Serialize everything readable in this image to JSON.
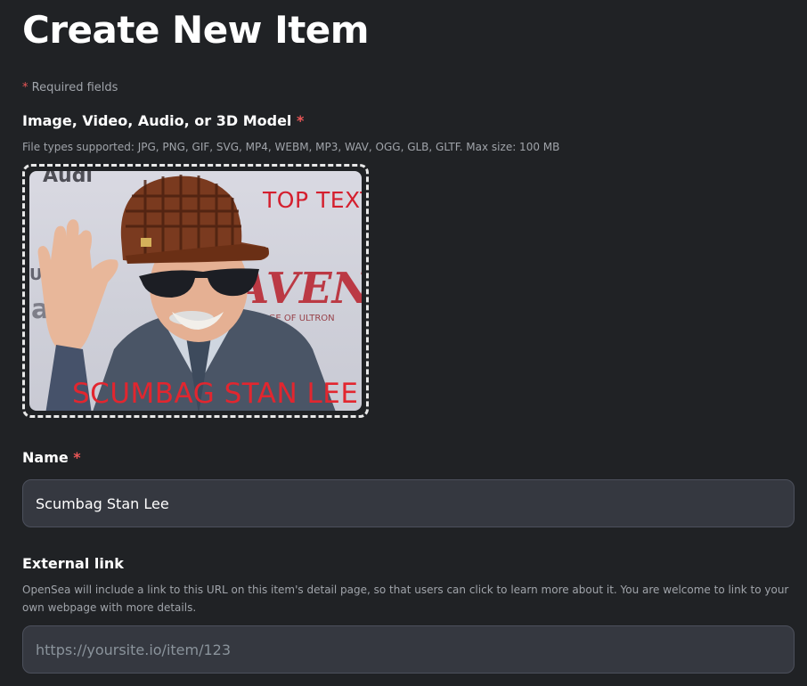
{
  "page": {
    "title": "Create New Item",
    "required_star": "*",
    "required_text": " Required fields"
  },
  "media": {
    "label": "Image, Video, Audio, or 3D Model",
    "star": "*",
    "supported": "File types supported: JPG, PNG, GIF, SVG, MP4, WEBM, MP3, WAV, OGG, GLB, GLTF. Max size: 100 MB",
    "meme_top_text": "TOP TEXT",
    "meme_bottom_text": "SCUMBAG STAN LEE"
  },
  "name_field": {
    "label": "Name",
    "star": "*",
    "value": "Scumbag Stan Lee"
  },
  "external_link": {
    "label": "External link",
    "description": "OpenSea will include a link to this URL on this item's detail page, so that users can click to learn more about it. You are welcome to link to your own webpage with more details.",
    "placeholder": "https://yoursite.io/item/123"
  },
  "colors": {
    "background": "#202225",
    "field_background": "#353840",
    "required_star": "#eb5757"
  }
}
